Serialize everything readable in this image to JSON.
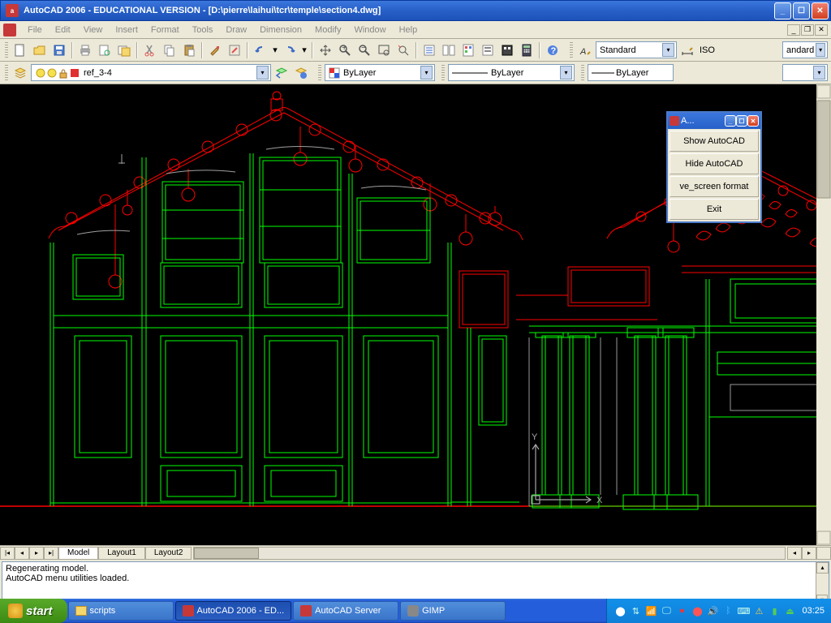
{
  "title_bar": {
    "app_name": "AutoCAD 2006 - EDUCATIONAL VERSION",
    "file_path": "[D:\\pierre\\laihui\\tcr\\temple\\section4.dwg]"
  },
  "menu": {
    "items": [
      "File",
      "Edit",
      "View",
      "Insert",
      "Format",
      "Tools",
      "Draw",
      "Dimension",
      "Modify",
      "Window",
      "Help"
    ]
  },
  "toolbar1": {
    "style_combo": "Standard",
    "dim_combo": "ISO",
    "right_combo": "andard"
  },
  "toolbar2": {
    "layer_combo": "ref_3-4",
    "color_combo": "ByLayer",
    "linetype_combo": "ByLayer",
    "lineweight_combo": "ByLayer"
  },
  "tabs": {
    "model": "Model",
    "l1": "Layout1",
    "l2": "Layout2"
  },
  "command_lines": [
    "Regenerating model.",
    "AutoCAD menu utilities loaded."
  ],
  "popup": {
    "title": "A...",
    "items": [
      "Show AutoCAD",
      "Hide AutoCAD",
      "ve_screen format",
      "Exit"
    ]
  },
  "taskbar": {
    "start": "start",
    "items": [
      {
        "label": "scripts",
        "icon": "folder"
      },
      {
        "label": "AutoCAD 2006 - ED...",
        "icon": "acad",
        "active": true
      },
      {
        "label": "AutoCAD Server",
        "icon": "acad"
      },
      {
        "label": "GIMP",
        "icon": "gimp"
      }
    ],
    "clock": "03:25"
  },
  "ucs": {
    "x": "X",
    "y": "Y"
  }
}
